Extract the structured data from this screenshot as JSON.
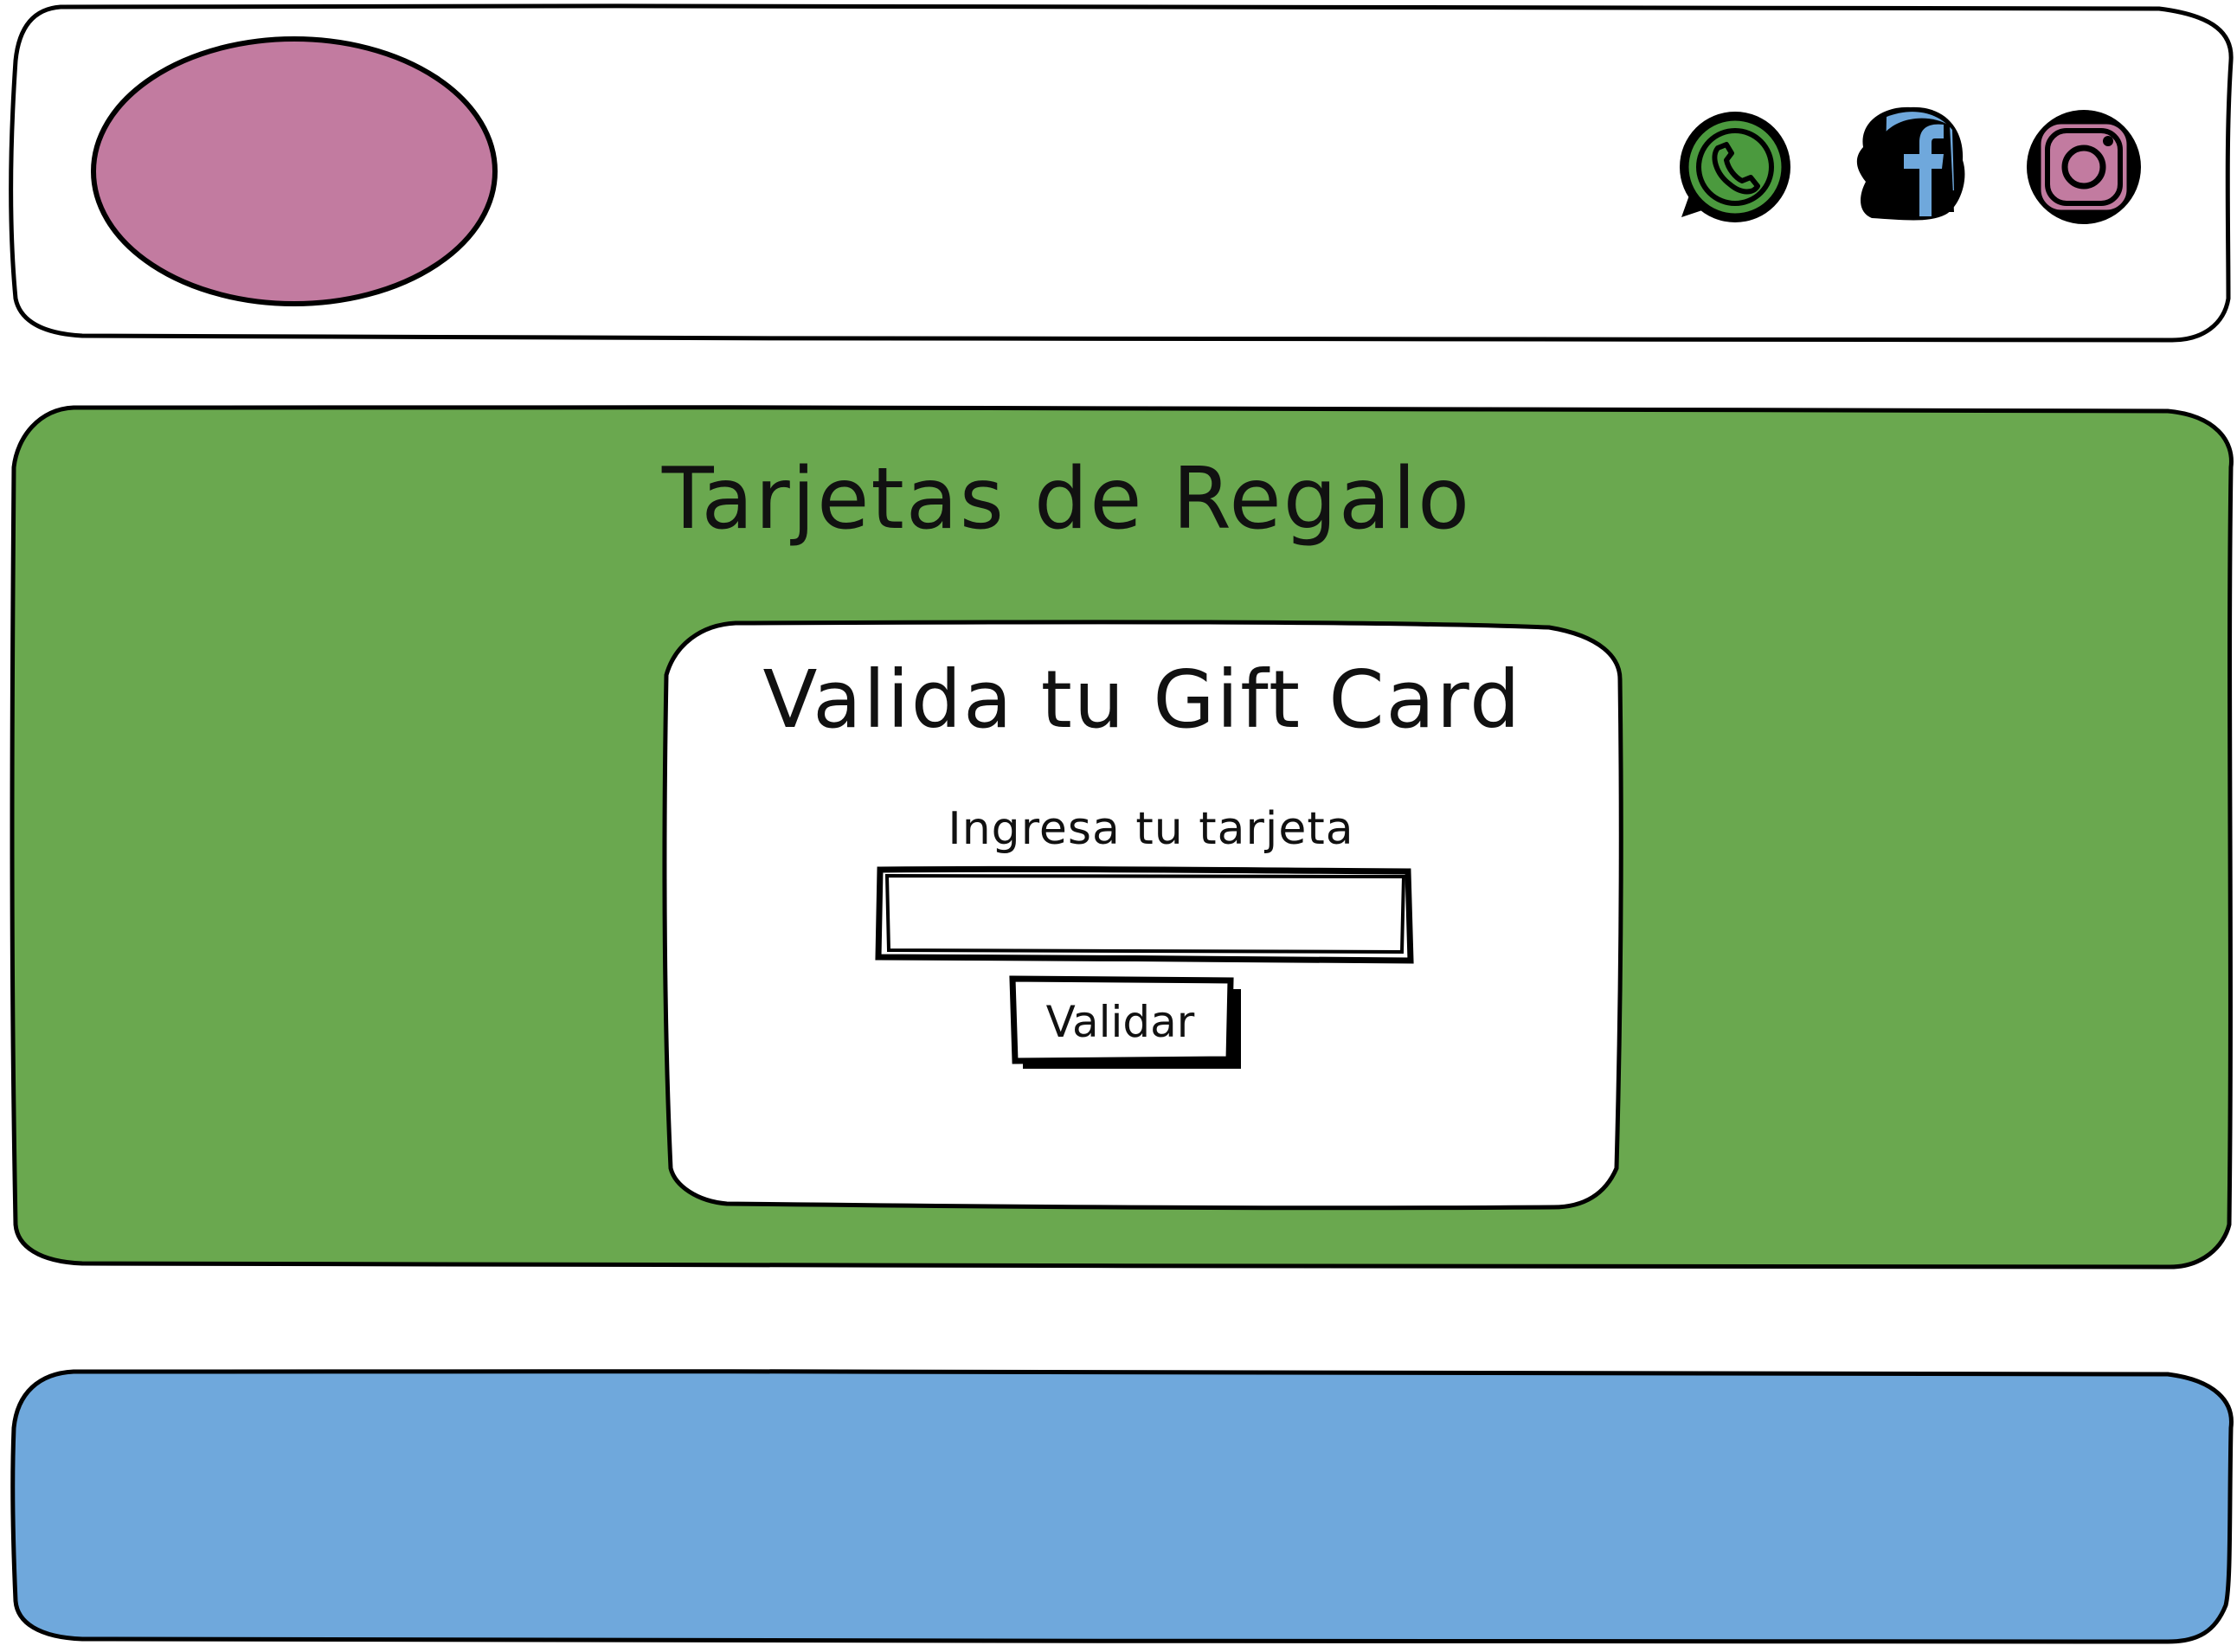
{
  "header": {
    "social": [
      {
        "name": "whatsapp-icon",
        "color": "#4b9a3e"
      },
      {
        "name": "facebook-icon",
        "color": "#6fa8dc"
      },
      {
        "name": "instagram-icon",
        "color": "#c27ba0"
      }
    ],
    "logo_color": "#c27ba0"
  },
  "main": {
    "title": "Tarjetas de Regalo",
    "background_color": "#6aa84f",
    "card": {
      "title": "Valida tu Gift Card",
      "label": "Ingresa tu tarjeta",
      "input_value": "",
      "button_label": "Validar"
    }
  },
  "footer": {
    "background_color": "#6fa8dc"
  }
}
